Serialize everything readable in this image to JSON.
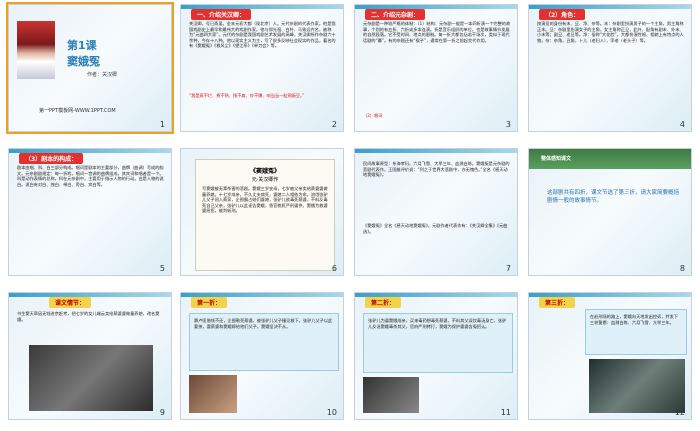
{
  "slides": [
    {
      "num": "1",
      "title": "第1课",
      "subtitle": "窦娥冤",
      "author": "作者：关汉卿",
      "footer": "第一PPT模板网-WWW.1PPT.COM"
    },
    {
      "num": "2",
      "header": "一、介绍关汉卿：",
      "body": "关汉卿，号已斋叟。金末元初大都（现北京）人。元代杂剧的代表作家。他是我国戏剧史上最早和最伟大的戏剧作家。他与郑光祖、白朴、马致远齐名，被称为“元曲四大家”。元代的杂剧是我国戏剧艺术发展的高峰，关汉卿所作杂剧六十余种，今存十八种。他以现实主义为主，写了很多反映社会现实的作品，著名的有《窦娥冤》《救风尘》《望江亭》《单刀会》等。",
      "highlight": "“我是蒸不烂、煮不熟、捶不扁、炒不爆、响当当一粒铜豌豆。”"
    },
    {
      "num": "3",
      "header": "二、介绍元杂剧：",
      "body": "元杂剧是一种较严格的体制：（1）结构：元杂剧一般是一本四折演一个完整的故事，个别的有五折、六折或多本连演。折是音乐组织的单位，也是故事情节发展的自然段落。它不受时间、地点的限制。每一折大都包括若干场次，类似于现代话剧的“幕”。有的杂剧还有“楔子”，通常在第一折之前起交代作用。",
      "term": "（2）唱词"
    },
    {
      "num": "4",
      "header": "（2）角色：",
      "body": "按演员的身份有末、旦、净、杂等。末：杂剧里扮演男子的一个主角，男主角称正末。旦：杂剧里扮演女子的主角，女主角称正旦，此外，配角有副末、外末、小末等；副旦、老旦等。净：俗称“大花脸”，大都扮演性格、相貌上有特点的人物。杂：杂角，丑角，卜儿（老妇人），孛老（老头子）等。"
    },
    {
      "num": "5",
      "header": "（3）剧本的构成：",
      "body": "剧本由唱、科、白三部分构成。唱词是剧本的主要部分，曲牌（曲调）写成的韵文。元杂剧剧规定：每一折戏，唱词一宫调的曲牌组成，其宾词和唱者是一个。科是动作表情的总称。科在元杂剧中，主要用于指示人物的行动。白是人物的说白。说白有对白、独白、带白、旁白、宾白等。"
    },
    {
      "num": "6",
      "title": "《窦娥冤》",
      "subtitle": "元·关汉卿作",
      "body": "写窦娥被无辜杀害的悲剧。窦娥三岁丧母，七岁被父亲卖给蔡婆婆做童养媳。十七岁成亲，不久丈夫病死，婆媳二人相依为命。流氓张驴儿父子闯入蔡家，企图霸占她们婆媳，张驴儿欲毒死蔡婆，不料反毒死自己父亲，张驴儿以此诬告窦娥，昏官桃杌严刑逼供，窦娥为救婆婆屈招，被判斩刑。"
    },
    {
      "num": "7",
      "body": "民间故事原型：东海孝妇。六月飞雪、大旱三年、血溅白练。窦娥冤是元杂剧的悲剧代表作。王国维评价说：“列之于世界大悲剧中，亦无愧色。”全名《感天动地窦娥冤》。",
      "extra": "《窦娥冤》全名《感天动地窦娥冤》。元剧作者代表作有：《关汉卿全集》《元曲选》。"
    },
    {
      "num": "8",
      "title": "整体感知课文",
      "body": "这部剧共有四折，课文节选了第三折，请大家简要概括剧情一般的故事情节。"
    },
    {
      "num": "9",
      "label": "课文情节：",
      "body": "书生窦天章因无钱进京赶考，把七岁的女儿端云卖给蔡婆婆做童养媳，改名窦娥。"
    },
    {
      "num": "10",
      "label": "第一折：",
      "body": "赛卢医借钱不还，企图勒死蔡婆，被张驴儿父子撞见救下。张驴儿父子以此要挟，要蔡婆和窦娥嫁给他们父子。窦娥坚决不从。"
    },
    {
      "num": "11",
      "label": "第二折：",
      "body": "张驴儿为逼窦娥成亲，买来毒药想毒死蔡婆，不料其父误饮毒汤身亡，张驴儿反诬窦娥毒杀其父，官府严刑拷打，窦娥为保护婆婆含冤招认。"
    },
    {
      "num": "12",
      "label": "第三折：",
      "body": "在赴刑场的路上，窦娥向天地发出控诉，并发下三桩誓愿：血溅白练、六月飞雪、亢旱三年。"
    }
  ]
}
